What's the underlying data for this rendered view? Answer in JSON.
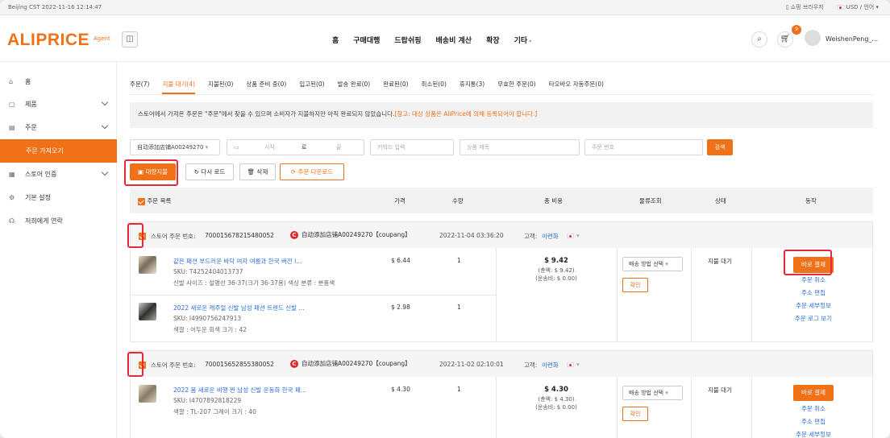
{
  "topbar": {
    "datetime": "Beijing CST  2022-11-16 12:14:47",
    "browser": "쇼핑 브라우저",
    "currency": "USD / 언어"
  },
  "header": {
    "logo": "ALIPRICE",
    "agent": "Agent",
    "nav": [
      "홈",
      "구매대행",
      "드랍쉬핑",
      "배송비 계산",
      "확장",
      "기타"
    ],
    "cart_count": "9",
    "username": "WeishenPeng_..."
  },
  "sidebar": {
    "items": [
      {
        "label": "홈",
        "icon": "home-icon"
      },
      {
        "label": "제품",
        "icon": "box-icon"
      },
      {
        "label": "주문",
        "icon": "order-icon"
      },
      {
        "label": "주문 가져오기",
        "icon": ""
      },
      {
        "label": "스토어 인증",
        "icon": "store-icon"
      },
      {
        "label": "기본 설정",
        "icon": "gear-icon"
      },
      {
        "label": "저희에게 연락",
        "icon": "headset-icon"
      }
    ]
  },
  "tabs": [
    "주문(7)",
    "지불 대기(4)",
    "지불된(0)",
    "상품 준비 중(0)",
    "입고된(0)",
    "발송 완료(0)",
    "완료된(0)",
    "취소된(0)",
    "휴지통(3)",
    "무효한 주문(0)",
    "타오바오 자동주문(0)"
  ],
  "notice": {
    "text": "스토어에서 가져온 주문은 \"주문\"에서 찾을 수 있으며 소비자가 지불하지만 아직 완료되지 않았습니다.",
    "highlight": "[참고: 대상 상품은 AliPrice에 의해 등록되어야 합니다.]"
  },
  "filters": {
    "store": "自动添加店铺A00249270",
    "date_start": "시작",
    "date_sep": "로",
    "date_end": "끝",
    "keyword": "키워드 입력",
    "product": "상품 제목",
    "order_no": "주문 번호",
    "search": "검색"
  },
  "actions": {
    "bulk_pay": "대량지불",
    "reload": "다시 로드",
    "delete": "삭제",
    "download": "주문 다운로드"
  },
  "table_head": {
    "list": "주문 목록",
    "price": "가격",
    "qty": "수량",
    "total": "총 비용",
    "logistics": "물류조회",
    "status": "상태",
    "action": "동작"
  },
  "orders": [
    {
      "order_label": "스토어 주문 번호:",
      "order_no": "700015678215480052",
      "shop": "自动添加店铺A00249270【coupang】",
      "date": "2022-11-04 03:36:20",
      "customer_label": "고객:",
      "customer": "이련화",
      "items": [
        {
          "name": "같은 패션 부드러운 바닥 여자 여름과 한국 버전 l...",
          "sku": "SKU:  T4252404013737",
          "attr": "신발 사이즈 : 설명선 36-37(크기 36-37용)  색상 분류 : 분홍색",
          "price": "$ 6.44",
          "qty": "1"
        },
        {
          "name": "2022 새로운 캐주얼 신발 남성 패션 트렌드 신발 ...",
          "sku": "SKU:  I4990756247913",
          "attr": "색깔 : 어두운 회색  크기 : 42",
          "price": "$ 2.98",
          "qty": "1"
        }
      ],
      "total": "$ 9.42",
      "total_items": "(총액: $ 9.42)",
      "shipping": "(운송비: $ 0.00)",
      "ship_select": "배송 방법 선택",
      "confirm": "확인",
      "status": "지불 대기",
      "pay": "바로 결제",
      "links": [
        "주문 취소",
        "주소 편집",
        "주문 세부정보",
        "주문 로그 보기"
      ]
    },
    {
      "order_label": "스토어 주문 번호:",
      "order_no": "700015652855380052",
      "shop": "自动添加店铺A00249270【coupang】",
      "date": "2022-11-02 02:10:01",
      "customer_label": "고객:",
      "customer": "이련화",
      "items": [
        {
          "name": "2022 봄 새로운 비행 짠 남성 신발 운동화 한국 패...",
          "sku": "SKU:  I4707892818229",
          "attr": "색깔 : TL-207 그레이  크기 : 40",
          "price": "$ 4.30",
          "qty": "1"
        }
      ],
      "total": "$ 4.30",
      "total_items": "(총액: $ 4.30)",
      "shipping": "(운송비: $ 0.00)",
      "ship_select": "배송 방법 선택",
      "confirm": "확인",
      "status": "지불 대기",
      "pay": "바로 결제",
      "links": [
        "주문 취소",
        "주소 편집",
        "주문 세부정보"
      ]
    }
  ]
}
